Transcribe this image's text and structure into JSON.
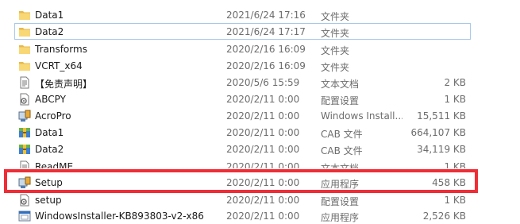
{
  "files": [
    {
      "name": "Data1",
      "date": "2021/6/24 17:16",
      "type": "文件夹",
      "size": "",
      "icon": "folder-icon"
    },
    {
      "name": "Data2",
      "date": "2021/6/24 17:17",
      "type": "文件夹",
      "size": "",
      "icon": "folder-icon"
    },
    {
      "name": "Transforms",
      "date": "2020/2/16 16:09",
      "type": "文件夹",
      "size": "",
      "icon": "folder-icon"
    },
    {
      "name": "VCRT_x64",
      "date": "2020/2/16 16:09",
      "type": "文件夹",
      "size": "",
      "icon": "folder-icon"
    },
    {
      "name": "【免责声明】",
      "date": "2020/5/6 15:59",
      "type": "文本文档",
      "size": "2 KB",
      "icon": "text-document-icon"
    },
    {
      "name": "ABCPY",
      "date": "2020/2/11 0:00",
      "type": "配置设置",
      "size": "1 KB",
      "icon": "config-file-icon"
    },
    {
      "name": "AcroPro",
      "date": "2020/2/11 0:00",
      "type": "Windows Install...",
      "size": "15,511 KB",
      "icon": "installer-icon"
    },
    {
      "name": "Data1",
      "date": "2020/2/11 0:00",
      "type": "CAB 文件",
      "size": "664,107 KB",
      "icon": "cab-archive-icon"
    },
    {
      "name": "Data2",
      "date": "2020/2/11 0:00",
      "type": "CAB 文件",
      "size": "34,119 KB",
      "icon": "cab-archive-icon"
    },
    {
      "name": "ReadME",
      "date": "2020/2/11 0:00",
      "type": "文本文档",
      "size": "1 KB",
      "icon": "text-document-icon"
    },
    {
      "name": "Setup",
      "date": "2020/2/11 0:00",
      "type": "应用程序",
      "size": "458 KB",
      "icon": "setup-app-icon"
    },
    {
      "name": "setup",
      "date": "2020/2/11 0:00",
      "type": "配置设置",
      "size": "1 KB",
      "icon": "config-file-icon"
    },
    {
      "name": "WindowsInstaller-KB893803-v2-x86",
      "date": "2020/2/11 0:00",
      "type": "应用程序",
      "size": "2,526 KB",
      "icon": "windows-app-icon"
    }
  ],
  "focused_index": 1,
  "highlighted_index": 10,
  "colors": {
    "highlight_border": "#ef2d36",
    "focus_border": "#a9c8ea",
    "folder": "#f8d775"
  }
}
